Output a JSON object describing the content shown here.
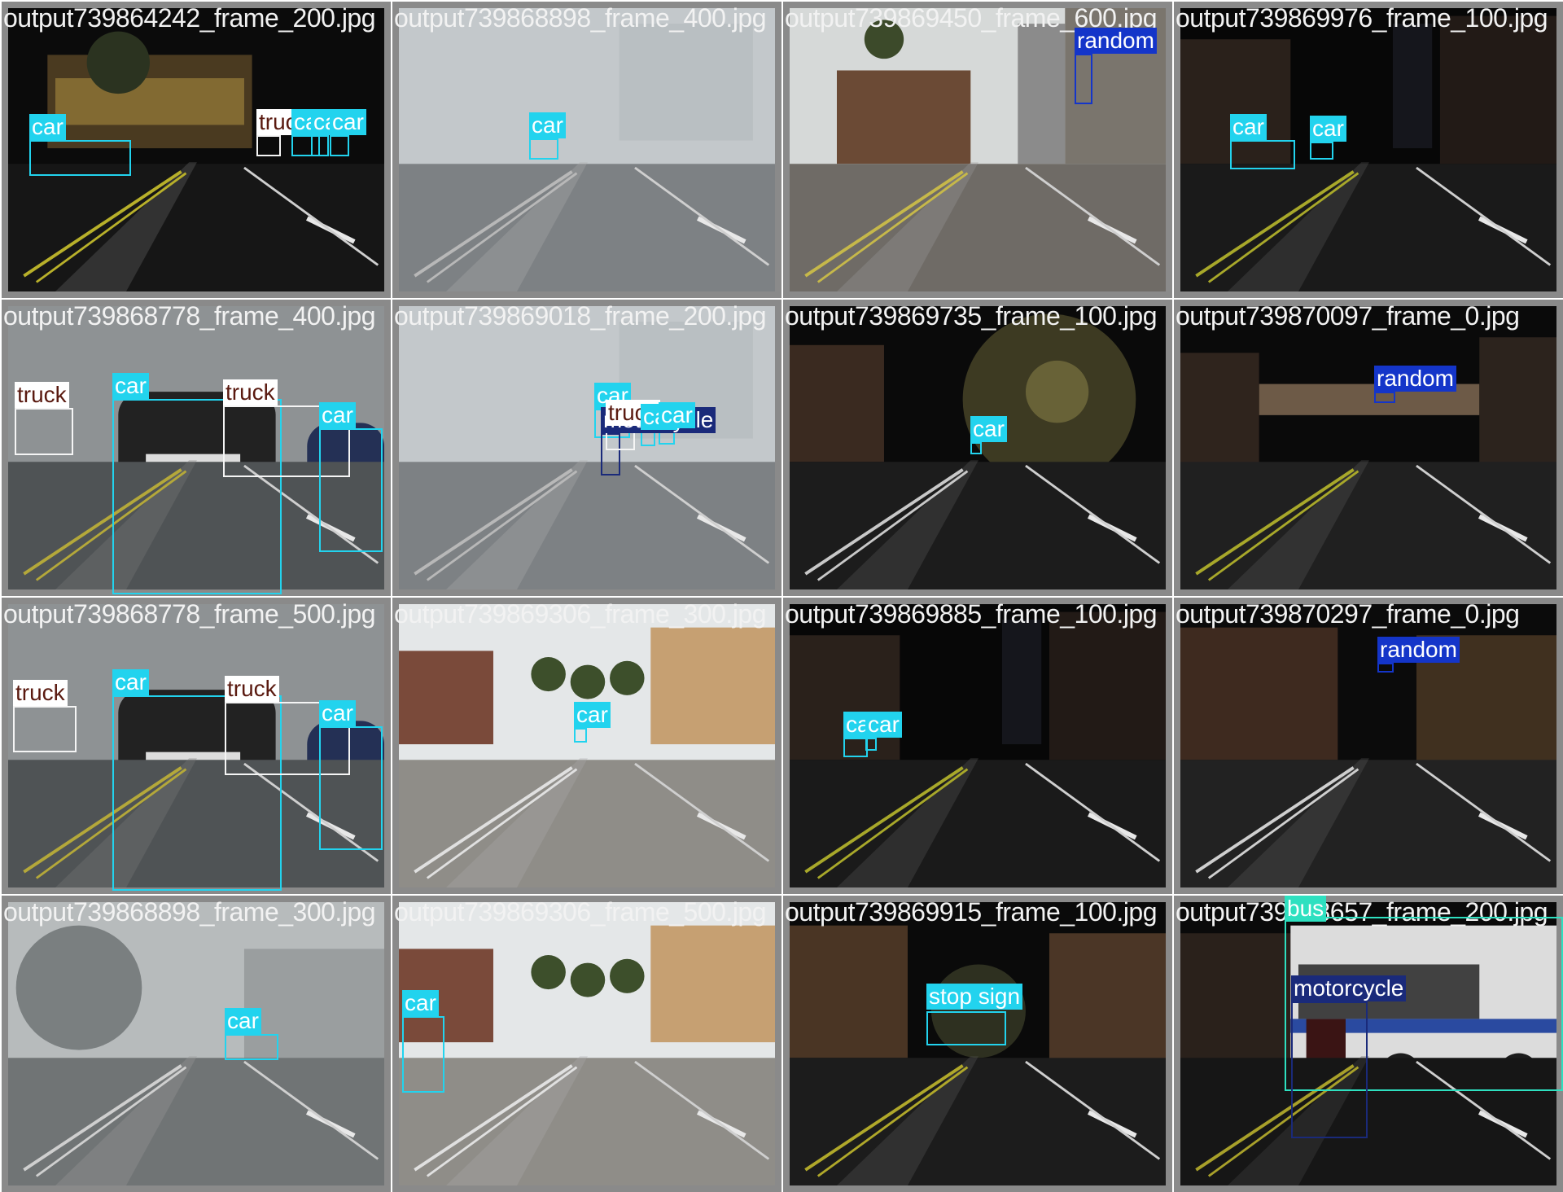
{
  "classes": {
    "car": {
      "box": "#22d3ee",
      "bg": "#22d3ee",
      "fg": "#ffffff"
    },
    "truck": {
      "box": "#f5f5f5",
      "bg": "#ffffff",
      "fg": "#5a1a10"
    },
    "random": {
      "box": "#1435c9",
      "bg": "#1435c9",
      "fg": "#ffffff"
    },
    "motorcycle": {
      "box": "#1a2a7a",
      "bg": "#1a2a7a",
      "fg": "#ffffff"
    },
    "bus": {
      "box": "#2ee0c0",
      "bg": "#2ee0c0",
      "fg": "#ffffff"
    },
    "stop sign": {
      "box": "#22d3ee",
      "bg": "#22d3ee",
      "fg": "#ffffff"
    }
  },
  "tiles": [
    {
      "file": "output739864242_frame_200.jpg",
      "scene": "night-plaza",
      "detections": [
        {
          "label": "car"
        },
        {
          "label": "truck"
        },
        {
          "label": "car"
        },
        {
          "label": "car"
        },
        {
          "label": "car"
        }
      ]
    },
    {
      "file": "output739868898_frame_400.jpg",
      "scene": "fog-rain",
      "detections": [
        {
          "label": "car"
        }
      ]
    },
    {
      "file": "output739869450_frame_600.jpg",
      "scene": "day-city",
      "detections": [
        {
          "label": "random"
        }
      ]
    },
    {
      "file": "output739869976_frame_100.jpg",
      "scene": "night-city",
      "detections": [
        {
          "label": "car"
        },
        {
          "label": "car"
        }
      ]
    },
    {
      "file": "output739868778_frame_400.jpg",
      "scene": "fog-suv",
      "detections": [
        {
          "label": "car"
        },
        {
          "label": "truck"
        },
        {
          "label": "truck"
        },
        {
          "label": "car"
        }
      ]
    },
    {
      "file": "output739869018_frame_200.jpg",
      "scene": "fog-rain",
      "detections": [
        {
          "label": "car"
        },
        {
          "label": "motorcycle"
        },
        {
          "label": "truck"
        },
        {
          "label": "car"
        },
        {
          "label": "car"
        }
      ]
    },
    {
      "file": "output739869735_frame_100.jpg",
      "scene": "night-tree",
      "detections": [
        {
          "label": "car"
        }
      ]
    },
    {
      "file": "output739870097_frame_0.jpg",
      "scene": "night-bridge",
      "detections": [
        {
          "label": "random"
        }
      ]
    },
    {
      "file": "output739868778_frame_500.jpg",
      "scene": "fog-suv",
      "detections": [
        {
          "label": "car"
        },
        {
          "label": "truck"
        },
        {
          "label": "truck"
        },
        {
          "label": "car"
        }
      ]
    },
    {
      "file": "output739869306_frame_300.jpg",
      "scene": "day-palms",
      "detections": [
        {
          "label": "car"
        }
      ]
    },
    {
      "file": "output739869885_frame_100.jpg",
      "scene": "night-city",
      "detections": [
        {
          "label": "car"
        },
        {
          "label": "car"
        }
      ]
    },
    {
      "file": "output739870297_frame_0.jpg",
      "scene": "night-brick",
      "detections": [
        {
          "label": "random"
        }
      ]
    },
    {
      "file": "output739868898_frame_300.jpg",
      "scene": "fog-trees",
      "detections": [
        {
          "label": "car"
        }
      ]
    },
    {
      "file": "output739869306_frame_500.jpg",
      "scene": "day-palms",
      "detections": [
        {
          "label": "car"
        }
      ]
    },
    {
      "file": "output739869915_frame_100.jpg",
      "scene": "night-stop",
      "detections": [
        {
          "label": "stop sign"
        }
      ]
    },
    {
      "file": "output739868657_frame_200.jpg",
      "scene": "night-bus",
      "detections": [
        {
          "label": "bus"
        },
        {
          "label": "motorcycle"
        }
      ]
    }
  ]
}
